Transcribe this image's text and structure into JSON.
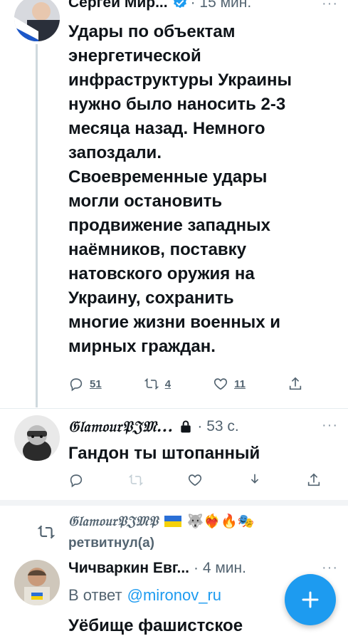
{
  "tweet1": {
    "author": "Сергей Мир...",
    "time": "· 15 мин.",
    "text_lines": [
      "Удары по объектам",
      "энергетической",
      "инфраструктуры Украины",
      "нужно было наносить 2-3",
      "месяца назад. Немного",
      "запоздали.",
      "Своевременные удары",
      "могли остановить",
      "продвижение западных",
      "наёмников, поставку",
      "натовского оружия на",
      "Украину, сохранить",
      "многие жизни военных и",
      "мирных граждан."
    ],
    "replies": "51",
    "retweets": "4",
    "likes": "11"
  },
  "tweet2": {
    "author": "𝔊𝔩𝔞𝔪𝔬𝔲𝔯𝔓𝔍𝔐...",
    "time": "· 53 с.",
    "text": "Гандон ты штопанный"
  },
  "retweet_header": {
    "user": "𝔊𝔩𝔞𝔪𝔬𝔲𝔯𝔓𝔍𝔐𝔓",
    "emojis": "🐺❤️‍🔥🔥🎭",
    "action": "ретвитнул(а)"
  },
  "tweet3": {
    "author": "Чичваркин Евг...",
    "time": "· 4 мин.",
    "reply_prefix": "В ответ",
    "reply_to": "@mironov_ru",
    "text": "Уёбище фашистское"
  },
  "icons": {
    "verified": "verified-badge-icon",
    "lock": "lock-icon",
    "reply": "reply-icon",
    "retweet": "retweet-icon",
    "like": "heart-icon",
    "share": "share-icon",
    "download": "download-icon",
    "compose": "compose-plus-icon"
  },
  "colors": {
    "accent": "#1d9bf0",
    "muted": "#536471",
    "divider": "#e6ecf0"
  }
}
